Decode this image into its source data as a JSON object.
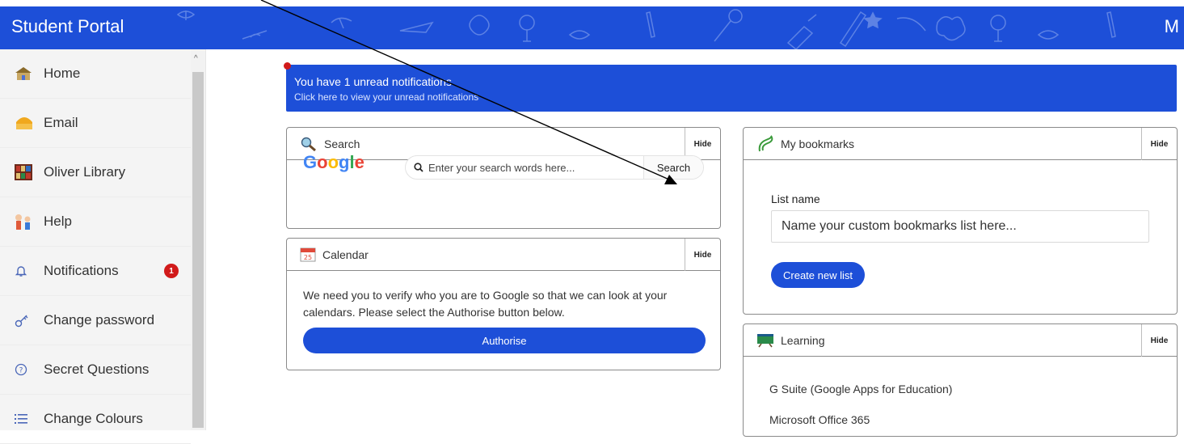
{
  "header": {
    "title": "Student Portal",
    "user_initial": "M"
  },
  "sidebar": {
    "items": [
      {
        "label": "Home",
        "icon": "home-icon"
      },
      {
        "label": "Email",
        "icon": "email-icon"
      },
      {
        "label": "Oliver Library",
        "icon": "library-icon"
      },
      {
        "label": "Help",
        "icon": "help-icon"
      },
      {
        "label": "Notifications",
        "icon": "bell-icon",
        "badge": "1"
      },
      {
        "label": "Change password",
        "icon": "key-icon"
      },
      {
        "label": "Secret Questions",
        "icon": "question-icon"
      },
      {
        "label": "Change Colours",
        "icon": "list-icon"
      }
    ]
  },
  "notification": {
    "line1": "You have 1 unread notifications",
    "line2": "Click here to view your unread notifications"
  },
  "search_card": {
    "title": "Search",
    "hide": "Hide",
    "logo": "Google",
    "placeholder": "Enter your search words here...",
    "button": "Search"
  },
  "calendar_card": {
    "title": "Calendar",
    "hide": "Hide",
    "message": "We need you to verify who you are to Google so that we can look at your calendars. Please select the Authorise button below.",
    "button": "Authorise"
  },
  "bookmarks_card": {
    "title": "My bookmarks",
    "hide": "Hide",
    "list_label": "List name",
    "list_placeholder": "Name your custom bookmarks list here...",
    "button": "Create new list"
  },
  "learning_card": {
    "title": "Learning",
    "hide": "Hide",
    "items": [
      "G Suite (Google Apps for Education)",
      "Microsoft Office 365"
    ]
  },
  "colors": {
    "brand_blue": "#1d4fd8",
    "badge_red": "#d11a1a"
  }
}
